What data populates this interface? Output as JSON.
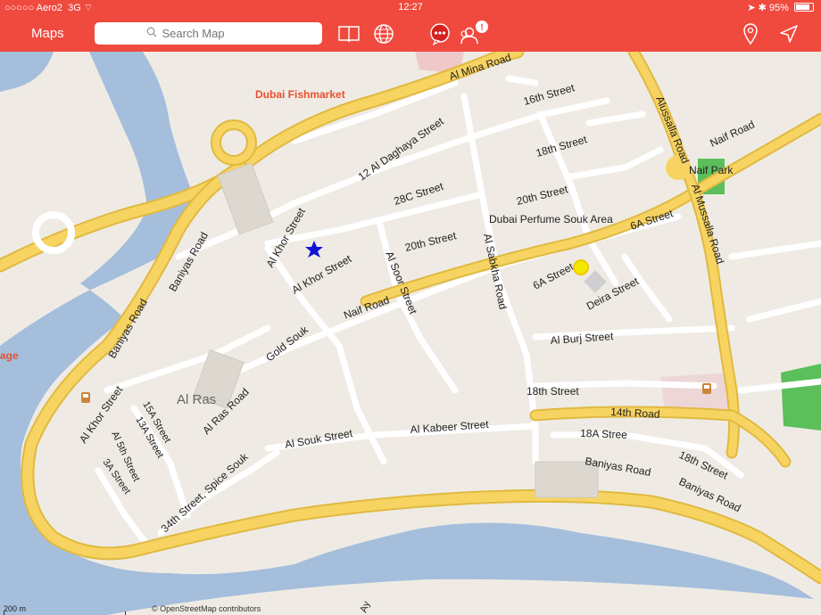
{
  "status": {
    "carrier": "○○○○○ Aero2",
    "network": "3G",
    "time": "12:27",
    "battery": "95%",
    "battery_level": 0.95
  },
  "toolbar": {
    "title": "Maps",
    "search_placeholder": "Search Map"
  },
  "map": {
    "places": {
      "fishmarket": "Dubai Fishmarket",
      "perfume_souk": "Dubai Perfume Souk Area",
      "naif_park": "Naif Park",
      "al_ras": "Al Ras",
      "edge_label": "age"
    },
    "streets": {
      "al_mina": "Al Mina Road",
      "baniyas_1": "Baniyas Road",
      "baniyas_2": "Baniyas Road",
      "baniyas_3": "Baniyas Road",
      "baniyas_4": "Baniyas Road",
      "baniyas_5": "Baniyas Road",
      "al_khor_1": "Al Khor Street",
      "al_khor_2": "Al Khor Street",
      "al_khor_3": "Al Khor Street",
      "al_daghaya": "12 Al Daghaya Street",
      "s16": "16th Street",
      "s18": "18th Street",
      "s28c": "28C Street",
      "s20": "20th Street",
      "s20b": "20th Street",
      "al_soor": "Al Soor Street",
      "al_sabkha": "Al Sabkha Road",
      "naif_road": "Naif Road",
      "naif_road_2": "Naif Road",
      "alussalla": "Alussalla Road",
      "al_mussalla": "Al Mussalla Road",
      "s6a": "6A Street",
      "s6a_2": "6A Street",
      "deira": "Deira Street",
      "gold_souk": "Gold Souk",
      "al_burj": "Al Burj Street",
      "s18b": "18th Street",
      "s14": "14th Road",
      "al_ras_road": "Al Ras Road",
      "al_kabeer": "Al Kabeer Street",
      "al_souk": "Al Souk Street",
      "s18a": "18A Stree",
      "s18c": "18th Street",
      "s15a": "15A Street",
      "s13a": "13A Street",
      "s5th": "Al 5th Street",
      "s3a": "3A Street",
      "s34": "34th Street, Spice Souk",
      "edge_bottom": "Ay"
    },
    "scale": "200 m",
    "attribution": "© OpenStreetMap contributors",
    "colors": {
      "water": "#a4bedc",
      "land": "#efebe4",
      "road_major": "#f7d462",
      "road_casing": "#e0b941",
      "park": "#5bbf5b",
      "place_label": "#e7512f",
      "accent": "#f04a3f"
    }
  }
}
